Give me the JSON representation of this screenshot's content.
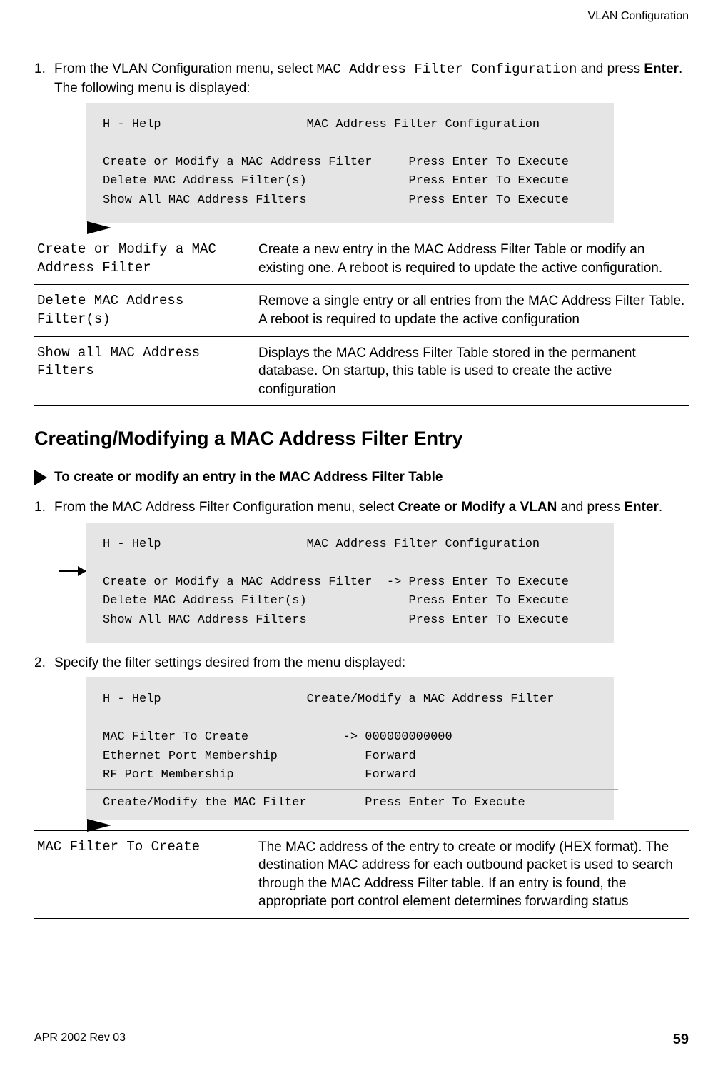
{
  "header": {
    "right": "VLAN Configuration"
  },
  "step1": {
    "num": "1.",
    "pre": "From the VLAN Configuration menu, select ",
    "code": "MAC Address Filter Configuration",
    "mid1": " and press ",
    "bold1": "Enter",
    "post": ".   The following menu is displayed:"
  },
  "code1": "H - Help                    MAC Address Filter Configuration\n\nCreate or Modify a MAC Address Filter     Press Enter To Execute\nDelete MAC Address Filter(s)              Press Enter To Execute\nShow All MAC Address Filters              Press Enter To Execute",
  "defs1": [
    {
      "term": "Create or Modify a MAC Address Filter",
      "desc": "Create a new entry in the MAC Address Filter Table or modify an existing one. A reboot is required to update the active configuration."
    },
    {
      "term": "Delete MAC Address Filter(s)",
      "desc": "Remove a single entry or all entries from the MAC Address Filter Table. A reboot is required to update the active configuration"
    },
    {
      "term": "Show all MAC Address Filters",
      "desc": "Displays the MAC Address Filter Table stored in the permanent database. On startup, this table is used to create the active configuration"
    }
  ],
  "section2": "Creating/Modifying a MAC Address Filter Entry",
  "procline": "To create or modify an entry in the MAC Address Filter Table",
  "step2": {
    "num": "1.",
    "pre": "From the MAC Address Filter Configuration menu, select ",
    "bold1": "Create or Modify a VLAN",
    "mid": "  and press ",
    "bold2": "Enter",
    "post": "."
  },
  "code2_a": "H - Help                    MAC Address Filter Configuration\n",
  "code2_b": "Create or Modify a MAC Address Filter  -> Press Enter To Execute",
  "code2_c": "Delete MAC Address Filter(s)              Press Enter To Execute\nShow All MAC Address Filters              Press Enter To Execute",
  "step3": {
    "num": "2.",
    "text": "Specify the filter settings desired from the menu displayed:"
  },
  "code3_a": "H - Help                    Create/Modify a MAC Address Filter\n\nMAC Filter To Create             -> 000000000000\nEthernet Port Membership            Forward\nRF Port Membership                  Forward",
  "code3_b": "Create/Modify the MAC Filter        Press Enter To Execute",
  "defs2": [
    {
      "term": "MAC Filter To Create",
      "desc": "The MAC address of the entry to create or modify (HEX format). The destination MAC address for each outbound packet is used to search through the MAC Address Filter table. If an entry is found, the appropriate port control element determines forwarding status"
    }
  ],
  "footer": {
    "left": "APR 2002 Rev 03",
    "right": "59"
  }
}
